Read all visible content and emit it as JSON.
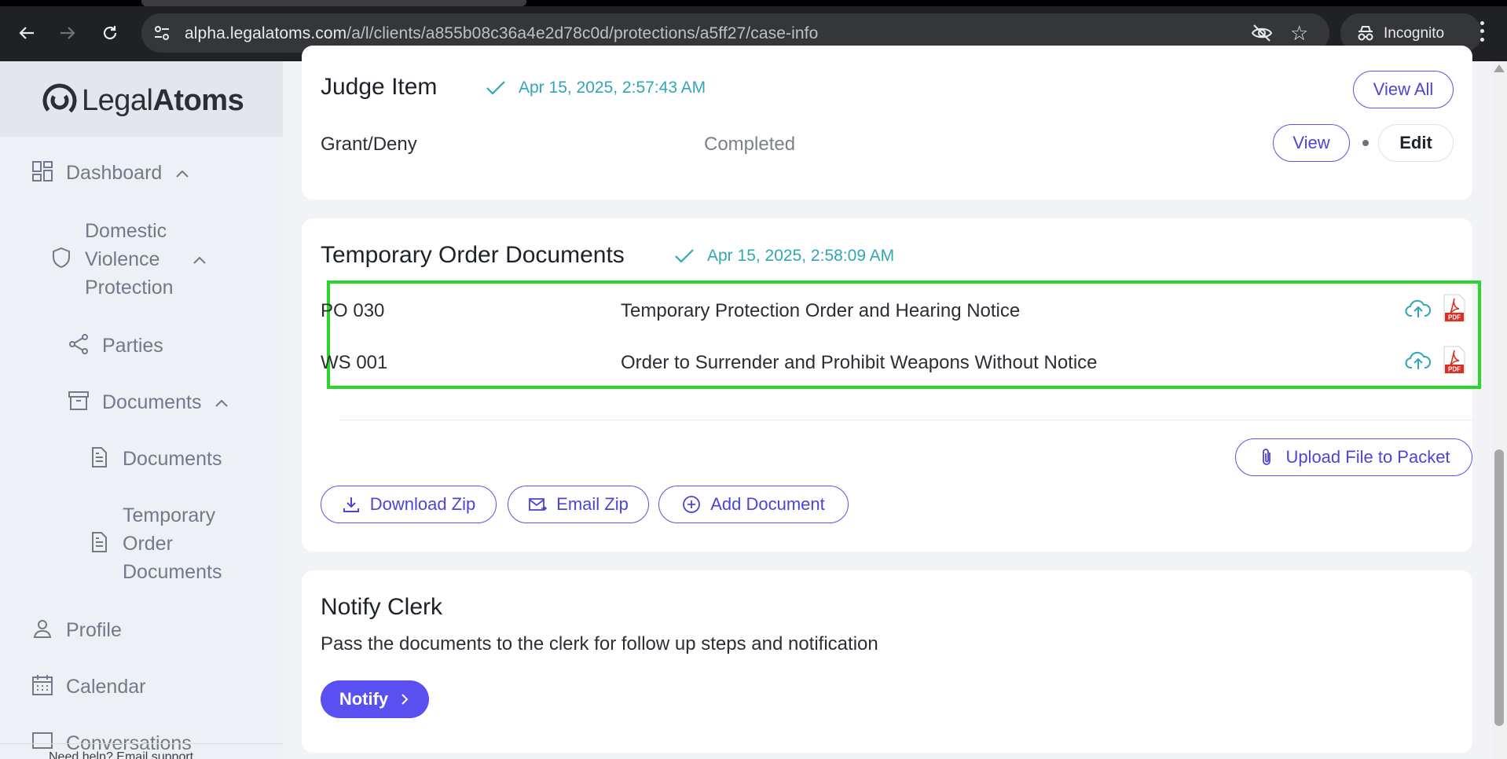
{
  "browser": {
    "url_host": "alpha.legalatoms.com",
    "url_path": "/a/l/clients/a855b08c36a4e2d78c0d/protections/a5ff27/case-info",
    "incognito_label": "Incognito"
  },
  "sidebar": {
    "logo_part1": "Legal",
    "logo_part2": "Atoms",
    "items": [
      {
        "label": "Dashboard"
      },
      {
        "label": "Domestic Violence Protection"
      },
      {
        "label": "Parties"
      },
      {
        "label": "Documents"
      },
      {
        "label": "Documents"
      },
      {
        "label": "Temporary Order Documents"
      },
      {
        "label": "Profile"
      },
      {
        "label": "Calendar"
      },
      {
        "label": "Conversations"
      }
    ],
    "footer_text": "Need help? Email support"
  },
  "judge_item": {
    "title": "Judge Item",
    "timestamp": "Apr 15, 2025, 2:57:43 AM",
    "view_all_label": "View All",
    "row_name": "Grant/Deny",
    "row_status": "Completed",
    "view_label": "View",
    "edit_label": "Edit"
  },
  "temporary_order": {
    "title": "Temporary Order Documents",
    "timestamp": "Apr 15, 2025, 2:58:09 AM",
    "documents": [
      {
        "code": "PO 030",
        "name": "Temporary Protection Order and Hearing Notice"
      },
      {
        "code": "WS 001",
        "name": "Order to Surrender and Prohibit Weapons Without Notice"
      }
    ],
    "upload_label": "Upload File to Packet",
    "download_zip_label": "Download Zip",
    "email_zip_label": "Email Zip",
    "add_document_label": "Add Document",
    "pdf_badge": "PDF"
  },
  "notify_clerk": {
    "title": "Notify Clerk",
    "description": "Pass the documents to the clerk for follow up steps and notification",
    "notify_label": "Notify"
  },
  "colors": {
    "accent": "#5a4ff0",
    "timestamp": "#2fa7b5",
    "highlight": "#2bd62b"
  }
}
